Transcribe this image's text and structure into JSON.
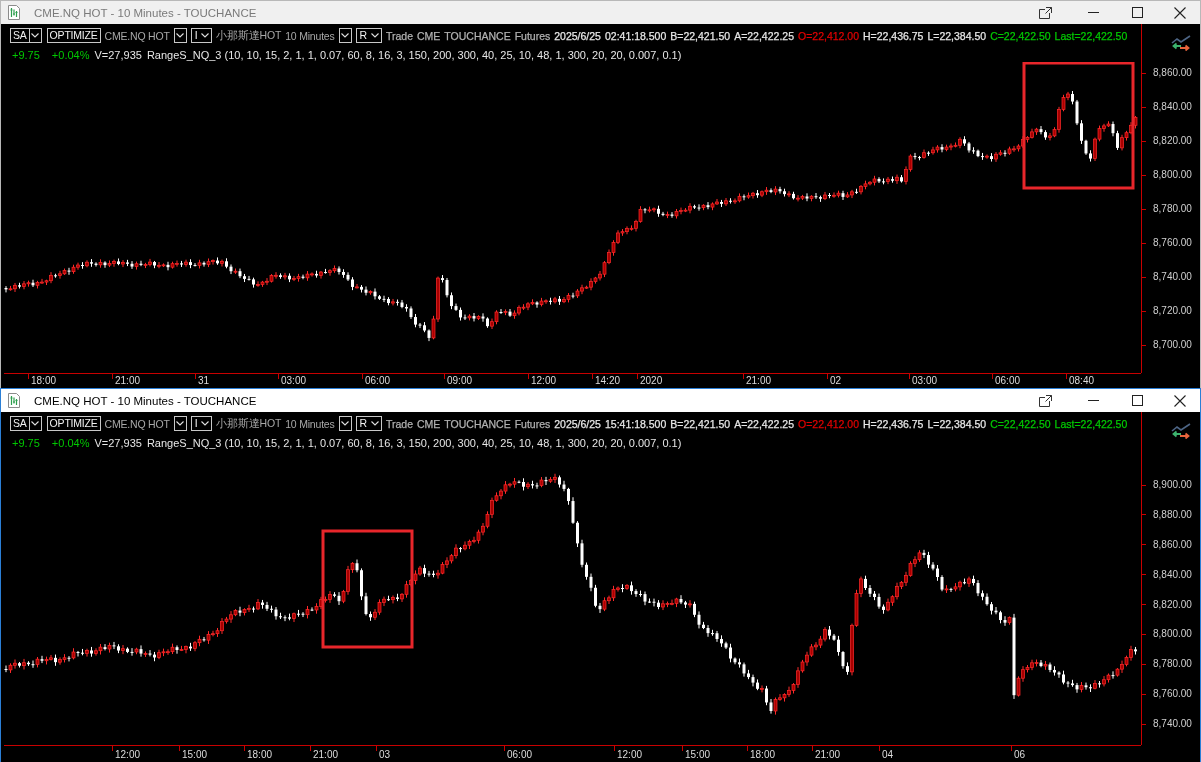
{
  "windows": [
    {
      "title": "CME.NQ HOT - 10 Minutes - TOUCHANCE",
      "active": false,
      "toolbar": [
        {
          "kind": "split",
          "label": "SA"
        },
        {
          "kind": "button",
          "label": "OPTIMIZE"
        },
        {
          "kind": "text",
          "label": "CME.NQ HOT"
        },
        {
          "kind": "dropdown"
        },
        {
          "kind": "dropdown",
          "label": "I"
        },
        {
          "kind": "text",
          "label": "小那斯達HOT"
        },
        {
          "kind": "text",
          "label": "10 Minutes"
        },
        {
          "kind": "dropdown"
        },
        {
          "kind": "dropdown",
          "label": "R"
        }
      ],
      "quote": [
        {
          "text": "Trade",
          "color": "#b0b0b0"
        },
        {
          "text": "CME",
          "color": "#b0b0b0"
        },
        {
          "text": "TOUCHANCE",
          "color": "#b0b0b0"
        },
        {
          "text": "Futures",
          "color": "#b0b0b0"
        },
        {
          "text": "2025/6/25",
          "color": "#e6e6e6"
        },
        {
          "text": "02:41:18.500",
          "color": "#e6e6e6"
        },
        {
          "text": "B=22,421.50",
          "color": "#e6e6e6"
        },
        {
          "text": "A=22,422.25",
          "color": "#e6e6e6"
        },
        {
          "text": "O=22,412.00",
          "color": "#e00000"
        },
        {
          "text": "H=22,436.75",
          "color": "#e6e6e6"
        },
        {
          "text": "L=22,384.50",
          "color": "#e6e6e6"
        },
        {
          "text": "C=22,422.50",
          "color": "#00c800"
        },
        {
          "text": "Last=22,422.50",
          "color": "#00c800"
        }
      ],
      "indicator": [
        {
          "text": "+9.75",
          "color": "#00c800"
        },
        {
          "text": "+0.04%",
          "color": "#00c800"
        },
        {
          "text": "V=27,935",
          "color": "#e6e6e6"
        },
        {
          "text": "RangeS_NQ_3 (10, 10, 15, 2, 1, 1, 0.07, 60, 8, 16, 3, 150, 200, 300, 40, 25, 10, 48, 1, 300, 20, 20, 0.007, 0.1)",
          "color": "#e6e6e6"
        }
      ],
      "chart": {
        "highlighted": true,
        "price_labels": [
          "8,860.00",
          "8,840.00",
          "8,820.00",
          "8,800.00",
          "8,780.00",
          "8,760.00",
          "8,740.00",
          "8,720.00",
          "8,700.00"
        ],
        "time_labels": [
          "18:00",
          "21:00",
          "31",
          "03:00",
          "06:00",
          "09:00",
          "12:00",
          "14:20",
          "2020",
          "21:00",
          "02",
          "03:00",
          "06:00",
          "08:40"
        ]
      }
    },
    {
      "title": "CME.NQ HOT - 10 Minutes - TOUCHANCE",
      "active": true,
      "toolbar": [
        {
          "kind": "split",
          "label": "SA"
        },
        {
          "kind": "button",
          "label": "OPTIMIZE"
        },
        {
          "kind": "text",
          "label": "CME.NQ HOT"
        },
        {
          "kind": "dropdown"
        },
        {
          "kind": "dropdown",
          "label": "I"
        },
        {
          "kind": "text",
          "label": "小那斯達HOT"
        },
        {
          "kind": "text",
          "label": "10 Minutes"
        },
        {
          "kind": "dropdown"
        },
        {
          "kind": "dropdown",
          "label": "R"
        }
      ],
      "quote": [
        {
          "text": "Trade",
          "color": "#b0b0b0"
        },
        {
          "text": "CME",
          "color": "#b0b0b0"
        },
        {
          "text": "TOUCHANCE",
          "color": "#b0b0b0"
        },
        {
          "text": "Futures",
          "color": "#b0b0b0"
        },
        {
          "text": "2025/6/25",
          "color": "#e6e6e6"
        },
        {
          "text": "15:41:18.500",
          "color": "#e6e6e6"
        },
        {
          "text": "B=22,421.50",
          "color": "#e6e6e6"
        },
        {
          "text": "A=22,422.25",
          "color": "#e6e6e6"
        },
        {
          "text": "O=22,412.00",
          "color": "#e00000"
        },
        {
          "text": "H=22,436.75",
          "color": "#e6e6e6"
        },
        {
          "text": "L=22,384.50",
          "color": "#e6e6e6"
        },
        {
          "text": "C=22,422.50",
          "color": "#00c800"
        },
        {
          "text": "Last=22,422.50",
          "color": "#00c800"
        }
      ],
      "indicator": [
        {
          "text": "+9.75",
          "color": "#00c800"
        },
        {
          "text": "+0.04%",
          "color": "#00c800"
        },
        {
          "text": "V=27,935",
          "color": "#e6e6e6"
        },
        {
          "text": "RangeS_NQ_3 (10, 10, 15, 2, 1, 1, 0.07, 60, 8, 16, 3, 150, 200, 300, 40, 25, 10, 48, 1, 300, 20, 20, 0.007, 0.1)",
          "color": "#e6e6e6"
        }
      ],
      "chart": {
        "highlighted": true,
        "price_labels": [
          "8,900.00",
          "8,880.00",
          "8,860.00",
          "8,840.00",
          "8,820.00",
          "8,800.00",
          "8,780.00",
          "8,760.00",
          "8,740.00"
        ],
        "time_labels": [
          "12:00",
          "15:00",
          "18:00",
          "21:00",
          "03",
          "06:00",
          "12:00",
          "15:00",
          "18:00",
          "21:00",
          "04",
          "06"
        ]
      }
    }
  ]
}
